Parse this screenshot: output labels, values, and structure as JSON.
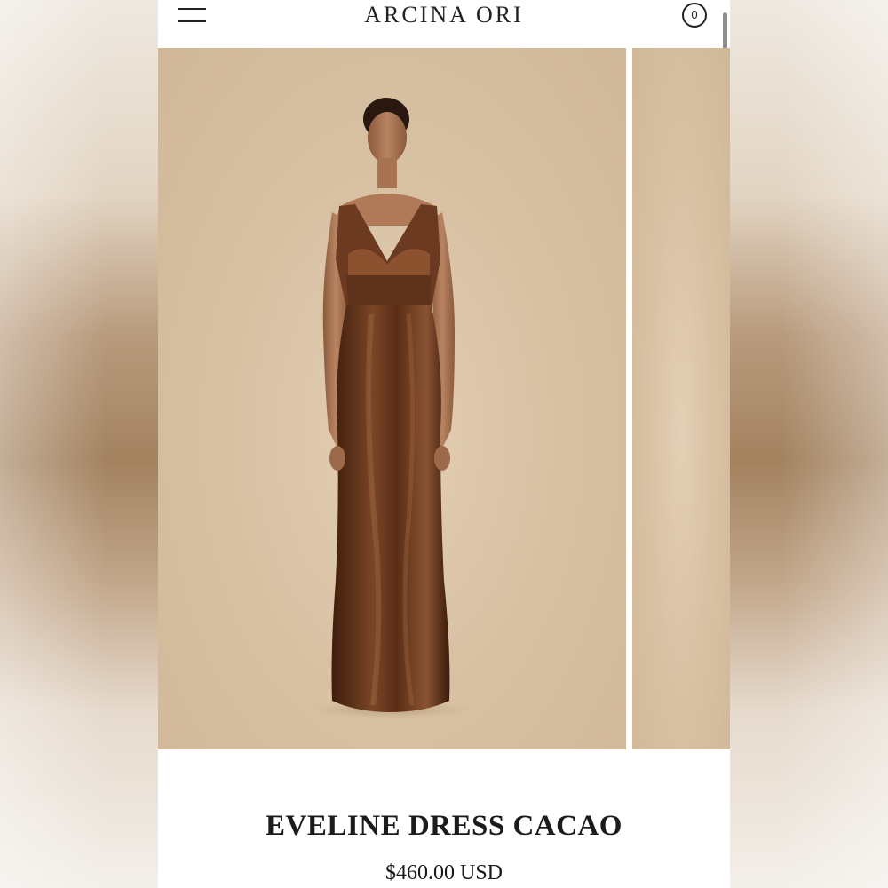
{
  "header": {
    "brand": "ARCINA ORI",
    "menu_icon": "hamburger-menu-icon",
    "cart_icon": "cart-circle-icon",
    "cart_count": "0"
  },
  "gallery": {
    "slides": [
      {
        "subject": "model wearing long brown satin slip dress with lace bodice"
      },
      {
        "subject": "next product image (partially visible)"
      }
    ]
  },
  "product": {
    "title": "EVELINE DRESS CACAO",
    "price": "$460.00 USD"
  },
  "colors": {
    "background": "#ffffff",
    "text": "#1b1b1b",
    "image_backdrop": "#d9c2a4",
    "dress": "#5c3018"
  }
}
